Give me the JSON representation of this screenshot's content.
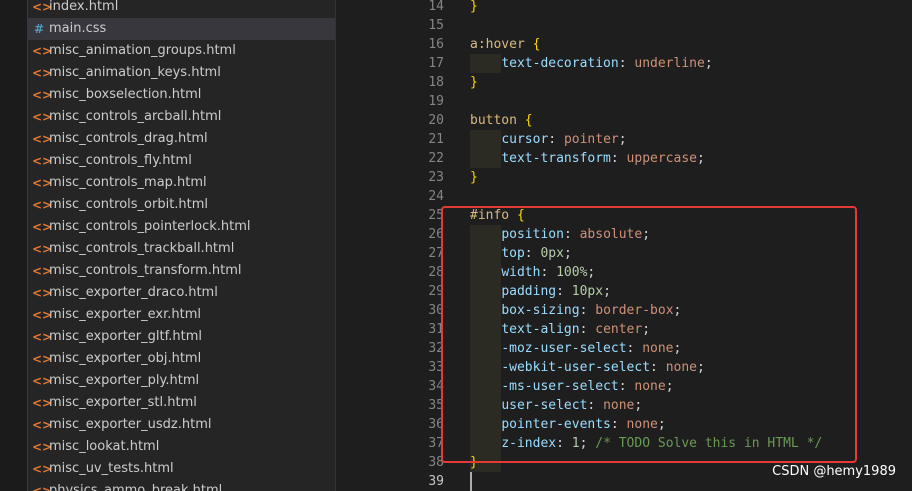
{
  "explorer": {
    "files": [
      {
        "icon": "html",
        "name": "index.html",
        "active": false
      },
      {
        "icon": "css",
        "name": "main.css",
        "active": true
      },
      {
        "icon": "html",
        "name": "misc_animation_groups.html",
        "active": false
      },
      {
        "icon": "html",
        "name": "misc_animation_keys.html",
        "active": false
      },
      {
        "icon": "html",
        "name": "misc_boxselection.html",
        "active": false
      },
      {
        "icon": "html",
        "name": "misc_controls_arcball.html",
        "active": false
      },
      {
        "icon": "html",
        "name": "misc_controls_drag.html",
        "active": false
      },
      {
        "icon": "html",
        "name": "misc_controls_fly.html",
        "active": false
      },
      {
        "icon": "html",
        "name": "misc_controls_map.html",
        "active": false
      },
      {
        "icon": "html",
        "name": "misc_controls_orbit.html",
        "active": false
      },
      {
        "icon": "html",
        "name": "misc_controls_pointerlock.html",
        "active": false
      },
      {
        "icon": "html",
        "name": "misc_controls_trackball.html",
        "active": false
      },
      {
        "icon": "html",
        "name": "misc_controls_transform.html",
        "active": false
      },
      {
        "icon": "html",
        "name": "misc_exporter_draco.html",
        "active": false
      },
      {
        "icon": "html",
        "name": "misc_exporter_exr.html",
        "active": false
      },
      {
        "icon": "html",
        "name": "misc_exporter_gltf.html",
        "active": false
      },
      {
        "icon": "html",
        "name": "misc_exporter_obj.html",
        "active": false
      },
      {
        "icon": "html",
        "name": "misc_exporter_ply.html",
        "active": false
      },
      {
        "icon": "html",
        "name": "misc_exporter_stl.html",
        "active": false
      },
      {
        "icon": "html",
        "name": "misc_exporter_usdz.html",
        "active": false
      },
      {
        "icon": "html",
        "name": "misc_lookat.html",
        "active": false
      },
      {
        "icon": "html",
        "name": "misc_uv_tests.html",
        "active": false
      },
      {
        "icon": "html",
        "name": "physics_ammo_break.html",
        "active": false
      }
    ],
    "icon_glyphs": {
      "html": "<>",
      "css": "#"
    }
  },
  "editor": {
    "current_line": "39",
    "lines": [
      {
        "n": "14",
        "tokens": [
          {
            "t": "brace",
            "v": "}"
          }
        ]
      },
      {
        "n": "15",
        "tokens": []
      },
      {
        "n": "16",
        "tokens": [
          {
            "t": "sel",
            "v": "a:hover"
          },
          {
            "t": "punc",
            "v": " "
          },
          {
            "t": "brace",
            "v": "{"
          }
        ]
      },
      {
        "n": "17",
        "tokens": [
          {
            "t": "punc",
            "v": "    "
          },
          {
            "t": "prop",
            "v": "text-decoration"
          },
          {
            "t": "punc",
            "v": ": "
          },
          {
            "t": "val",
            "v": "underline"
          },
          {
            "t": "punc",
            "v": ";"
          }
        ]
      },
      {
        "n": "18",
        "tokens": [
          {
            "t": "brace",
            "v": "}"
          }
        ]
      },
      {
        "n": "19",
        "tokens": []
      },
      {
        "n": "20",
        "tokens": [
          {
            "t": "sel",
            "v": "button"
          },
          {
            "t": "punc",
            "v": " "
          },
          {
            "t": "brace",
            "v": "{"
          }
        ]
      },
      {
        "n": "21",
        "tokens": [
          {
            "t": "punc",
            "v": "    "
          },
          {
            "t": "prop",
            "v": "cursor"
          },
          {
            "t": "punc",
            "v": ": "
          },
          {
            "t": "val",
            "v": "pointer"
          },
          {
            "t": "punc",
            "v": ";"
          }
        ]
      },
      {
        "n": "22",
        "tokens": [
          {
            "t": "punc",
            "v": "    "
          },
          {
            "t": "prop",
            "v": "text-transform"
          },
          {
            "t": "punc",
            "v": ": "
          },
          {
            "t": "val",
            "v": "uppercase"
          },
          {
            "t": "punc",
            "v": ";"
          }
        ]
      },
      {
        "n": "23",
        "tokens": [
          {
            "t": "brace",
            "v": "}"
          }
        ]
      },
      {
        "n": "24",
        "tokens": []
      },
      {
        "n": "25",
        "tokens": [
          {
            "t": "sel",
            "v": "#info"
          },
          {
            "t": "punc",
            "v": " "
          },
          {
            "t": "brace",
            "v": "{"
          }
        ]
      },
      {
        "n": "26",
        "tokens": [
          {
            "t": "punc",
            "v": "    "
          },
          {
            "t": "prop",
            "v": "position"
          },
          {
            "t": "punc",
            "v": ": "
          },
          {
            "t": "val",
            "v": "absolute"
          },
          {
            "t": "punc",
            "v": ";"
          }
        ]
      },
      {
        "n": "27",
        "tokens": [
          {
            "t": "punc",
            "v": "    "
          },
          {
            "t": "prop",
            "v": "top"
          },
          {
            "t": "punc",
            "v": ": "
          },
          {
            "t": "num",
            "v": "0px"
          },
          {
            "t": "punc",
            "v": ";"
          }
        ]
      },
      {
        "n": "28",
        "tokens": [
          {
            "t": "punc",
            "v": "    "
          },
          {
            "t": "prop",
            "v": "width"
          },
          {
            "t": "punc",
            "v": ": "
          },
          {
            "t": "num",
            "v": "100%"
          },
          {
            "t": "punc",
            "v": ";"
          }
        ]
      },
      {
        "n": "29",
        "tokens": [
          {
            "t": "punc",
            "v": "    "
          },
          {
            "t": "prop",
            "v": "padding"
          },
          {
            "t": "punc",
            "v": ": "
          },
          {
            "t": "num",
            "v": "10px"
          },
          {
            "t": "punc",
            "v": ";"
          }
        ]
      },
      {
        "n": "30",
        "tokens": [
          {
            "t": "punc",
            "v": "    "
          },
          {
            "t": "prop",
            "v": "box-sizing"
          },
          {
            "t": "punc",
            "v": ": "
          },
          {
            "t": "val",
            "v": "border-box"
          },
          {
            "t": "punc",
            "v": ";"
          }
        ]
      },
      {
        "n": "31",
        "tokens": [
          {
            "t": "punc",
            "v": "    "
          },
          {
            "t": "prop",
            "v": "text-align"
          },
          {
            "t": "punc",
            "v": ": "
          },
          {
            "t": "val",
            "v": "center"
          },
          {
            "t": "punc",
            "v": ";"
          }
        ]
      },
      {
        "n": "32",
        "tokens": [
          {
            "t": "punc",
            "v": "    "
          },
          {
            "t": "prop",
            "v": "-moz-user-select"
          },
          {
            "t": "punc",
            "v": ": "
          },
          {
            "t": "val",
            "v": "none"
          },
          {
            "t": "punc",
            "v": ";"
          }
        ]
      },
      {
        "n": "33",
        "tokens": [
          {
            "t": "punc",
            "v": "    "
          },
          {
            "t": "prop",
            "v": "-webkit-user-select"
          },
          {
            "t": "punc",
            "v": ": "
          },
          {
            "t": "val",
            "v": "none"
          },
          {
            "t": "punc",
            "v": ";"
          }
        ]
      },
      {
        "n": "34",
        "tokens": [
          {
            "t": "punc",
            "v": "    "
          },
          {
            "t": "prop",
            "v": "-ms-user-select"
          },
          {
            "t": "punc",
            "v": ": "
          },
          {
            "t": "val",
            "v": "none"
          },
          {
            "t": "punc",
            "v": ";"
          }
        ]
      },
      {
        "n": "35",
        "tokens": [
          {
            "t": "punc",
            "v": "    "
          },
          {
            "t": "prop",
            "v": "user-select"
          },
          {
            "t": "punc",
            "v": ": "
          },
          {
            "t": "val",
            "v": "none"
          },
          {
            "t": "punc",
            "v": ";"
          }
        ]
      },
      {
        "n": "36",
        "tokens": [
          {
            "t": "punc",
            "v": "    "
          },
          {
            "t": "prop",
            "v": "pointer-events"
          },
          {
            "t": "punc",
            "v": ": "
          },
          {
            "t": "val",
            "v": "none"
          },
          {
            "t": "punc",
            "v": ";"
          }
        ]
      },
      {
        "n": "37",
        "tokens": [
          {
            "t": "punc",
            "v": "    "
          },
          {
            "t": "prop",
            "v": "z-index"
          },
          {
            "t": "punc",
            "v": ": "
          },
          {
            "t": "num",
            "v": "1"
          },
          {
            "t": "punc",
            "v": "; "
          },
          {
            "t": "comment",
            "v": "/* TODO Solve this in HTML */"
          }
        ]
      },
      {
        "n": "38",
        "tokens": [
          {
            "t": "brace",
            "v": "}"
          }
        ]
      },
      {
        "n": "39",
        "tokens": []
      }
    ]
  },
  "annotation": {
    "color": "#e53935"
  },
  "watermark": {
    "text": "CSDN @hemy1989"
  },
  "colors": {
    "sel": "#d7ba7d",
    "prop": "#9cdcfe",
    "val": "#ce9178",
    "num": "#b5cea8",
    "brace": "#ffd700",
    "comment": "#6a9955"
  }
}
